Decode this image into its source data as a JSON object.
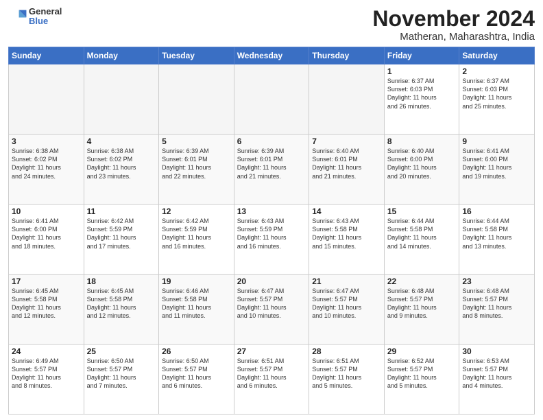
{
  "logo": {
    "general": "General",
    "blue": "Blue"
  },
  "header": {
    "month": "November 2024",
    "location": "Matheran, Maharashtra, India"
  },
  "weekdays": [
    "Sunday",
    "Monday",
    "Tuesday",
    "Wednesday",
    "Thursday",
    "Friday",
    "Saturday"
  ],
  "weeks": [
    [
      {
        "day": "",
        "info": ""
      },
      {
        "day": "",
        "info": ""
      },
      {
        "day": "",
        "info": ""
      },
      {
        "day": "",
        "info": ""
      },
      {
        "day": "",
        "info": ""
      },
      {
        "day": "1",
        "info": "Sunrise: 6:37 AM\nSunset: 6:03 PM\nDaylight: 11 hours\nand 26 minutes."
      },
      {
        "day": "2",
        "info": "Sunrise: 6:37 AM\nSunset: 6:03 PM\nDaylight: 11 hours\nand 25 minutes."
      }
    ],
    [
      {
        "day": "3",
        "info": "Sunrise: 6:38 AM\nSunset: 6:02 PM\nDaylight: 11 hours\nand 24 minutes."
      },
      {
        "day": "4",
        "info": "Sunrise: 6:38 AM\nSunset: 6:02 PM\nDaylight: 11 hours\nand 23 minutes."
      },
      {
        "day": "5",
        "info": "Sunrise: 6:39 AM\nSunset: 6:01 PM\nDaylight: 11 hours\nand 22 minutes."
      },
      {
        "day": "6",
        "info": "Sunrise: 6:39 AM\nSunset: 6:01 PM\nDaylight: 11 hours\nand 21 minutes."
      },
      {
        "day": "7",
        "info": "Sunrise: 6:40 AM\nSunset: 6:01 PM\nDaylight: 11 hours\nand 21 minutes."
      },
      {
        "day": "8",
        "info": "Sunrise: 6:40 AM\nSunset: 6:00 PM\nDaylight: 11 hours\nand 20 minutes."
      },
      {
        "day": "9",
        "info": "Sunrise: 6:41 AM\nSunset: 6:00 PM\nDaylight: 11 hours\nand 19 minutes."
      }
    ],
    [
      {
        "day": "10",
        "info": "Sunrise: 6:41 AM\nSunset: 6:00 PM\nDaylight: 11 hours\nand 18 minutes."
      },
      {
        "day": "11",
        "info": "Sunrise: 6:42 AM\nSunset: 5:59 PM\nDaylight: 11 hours\nand 17 minutes."
      },
      {
        "day": "12",
        "info": "Sunrise: 6:42 AM\nSunset: 5:59 PM\nDaylight: 11 hours\nand 16 minutes."
      },
      {
        "day": "13",
        "info": "Sunrise: 6:43 AM\nSunset: 5:59 PM\nDaylight: 11 hours\nand 16 minutes."
      },
      {
        "day": "14",
        "info": "Sunrise: 6:43 AM\nSunset: 5:58 PM\nDaylight: 11 hours\nand 15 minutes."
      },
      {
        "day": "15",
        "info": "Sunrise: 6:44 AM\nSunset: 5:58 PM\nDaylight: 11 hours\nand 14 minutes."
      },
      {
        "day": "16",
        "info": "Sunrise: 6:44 AM\nSunset: 5:58 PM\nDaylight: 11 hours\nand 13 minutes."
      }
    ],
    [
      {
        "day": "17",
        "info": "Sunrise: 6:45 AM\nSunset: 5:58 PM\nDaylight: 11 hours\nand 12 minutes."
      },
      {
        "day": "18",
        "info": "Sunrise: 6:45 AM\nSunset: 5:58 PM\nDaylight: 11 hours\nand 12 minutes."
      },
      {
        "day": "19",
        "info": "Sunrise: 6:46 AM\nSunset: 5:58 PM\nDaylight: 11 hours\nand 11 minutes."
      },
      {
        "day": "20",
        "info": "Sunrise: 6:47 AM\nSunset: 5:57 PM\nDaylight: 11 hours\nand 10 minutes."
      },
      {
        "day": "21",
        "info": "Sunrise: 6:47 AM\nSunset: 5:57 PM\nDaylight: 11 hours\nand 10 minutes."
      },
      {
        "day": "22",
        "info": "Sunrise: 6:48 AM\nSunset: 5:57 PM\nDaylight: 11 hours\nand 9 minutes."
      },
      {
        "day": "23",
        "info": "Sunrise: 6:48 AM\nSunset: 5:57 PM\nDaylight: 11 hours\nand 8 minutes."
      }
    ],
    [
      {
        "day": "24",
        "info": "Sunrise: 6:49 AM\nSunset: 5:57 PM\nDaylight: 11 hours\nand 8 minutes."
      },
      {
        "day": "25",
        "info": "Sunrise: 6:50 AM\nSunset: 5:57 PM\nDaylight: 11 hours\nand 7 minutes."
      },
      {
        "day": "26",
        "info": "Sunrise: 6:50 AM\nSunset: 5:57 PM\nDaylight: 11 hours\nand 6 minutes."
      },
      {
        "day": "27",
        "info": "Sunrise: 6:51 AM\nSunset: 5:57 PM\nDaylight: 11 hours\nand 6 minutes."
      },
      {
        "day": "28",
        "info": "Sunrise: 6:51 AM\nSunset: 5:57 PM\nDaylight: 11 hours\nand 5 minutes."
      },
      {
        "day": "29",
        "info": "Sunrise: 6:52 AM\nSunset: 5:57 PM\nDaylight: 11 hours\nand 5 minutes."
      },
      {
        "day": "30",
        "info": "Sunrise: 6:53 AM\nSunset: 5:57 PM\nDaylight: 11 hours\nand 4 minutes."
      }
    ]
  ]
}
